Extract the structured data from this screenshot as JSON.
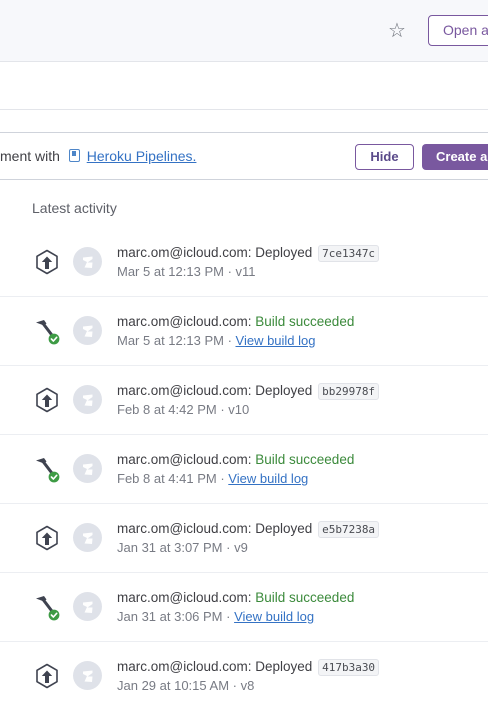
{
  "header": {
    "favorite_icon": "star-icon",
    "open_app_label": "Open a"
  },
  "banner": {
    "text_before": "ment with",
    "pipeline_icon": "pipeline-icon",
    "link_label": "Heroku Pipelines.",
    "hide_label": "Hide",
    "create_label": "Create a"
  },
  "activity": {
    "title": "Latest activity",
    "items": [
      {
        "type": "deploy",
        "icon": "deploy-arrow-icon",
        "user": "marc.om@icloud.com:",
        "action": "Deployed",
        "hash": "7ce1347c",
        "time": "Mar 5 at 12:13 PM",
        "sep": " · ",
        "tail": "v11"
      },
      {
        "type": "build",
        "icon": "hammer-check-icon",
        "user": "marc.om@icloud.com:",
        "action": "Build succeeded",
        "time": "Mar 5 at 12:13 PM",
        "sep": " · ",
        "tail": "View build log"
      },
      {
        "type": "deploy",
        "icon": "deploy-arrow-icon",
        "user": "marc.om@icloud.com:",
        "action": "Deployed",
        "hash": "bb29978f",
        "time": "Feb 8 at 4:42 PM",
        "sep": " · ",
        "tail": "v10"
      },
      {
        "type": "build",
        "icon": "hammer-check-icon",
        "user": "marc.om@icloud.com:",
        "action": "Build succeeded",
        "time": "Feb 8 at 4:41 PM",
        "sep": " · ",
        "tail": "View build log"
      },
      {
        "type": "deploy",
        "icon": "deploy-arrow-icon",
        "user": "marc.om@icloud.com:",
        "action": "Deployed",
        "hash": "e5b7238a",
        "time": "Jan 31 at 3:07 PM",
        "sep": " · ",
        "tail": "v9"
      },
      {
        "type": "build",
        "icon": "hammer-check-icon",
        "user": "marc.om@icloud.com:",
        "action": "Build succeeded",
        "time": "Jan 31 at 3:06 PM",
        "sep": " · ",
        "tail": "View build log"
      },
      {
        "type": "deploy",
        "icon": "deploy-arrow-icon",
        "user": "marc.om@icloud.com:",
        "action": "Deployed",
        "hash": "417b3a30",
        "time": "Jan 29 at 10:15 AM",
        "sep": " · ",
        "tail": "v8"
      }
    ]
  },
  "colors": {
    "accent": "#79589f",
    "link": "#3472c4",
    "success": "#3b8a3b"
  }
}
